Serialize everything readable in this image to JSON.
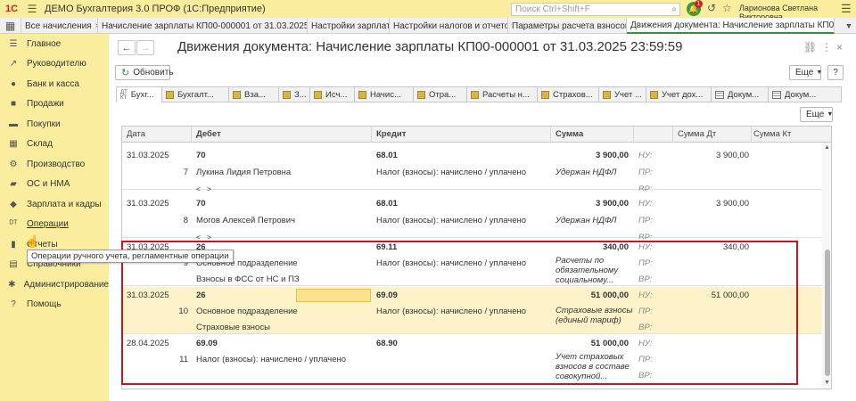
{
  "titlebar": {
    "logo": "1С",
    "title": "ДЕМО Бухгалтерия 3.0 ПРОФ  (1С:Предприятие)",
    "search_placeholder": "Поиск Ctrl+Shift+F",
    "notification_count": "1",
    "user": "Ларионова Светлана Викторовна"
  },
  "open_tabs": [
    {
      "label": "Все начисления"
    },
    {
      "label": "Начисление зарплаты КП00-000001 от 31.03.2025 2..."
    },
    {
      "label": "Настройки зарплаты"
    },
    {
      "label": "Настройки налогов и отчетов"
    },
    {
      "label": "Параметры расчета взносов"
    },
    {
      "label": "Движения документа: Начисление зарплаты КП0..."
    }
  ],
  "sidebar": {
    "items": [
      {
        "label": "Главное",
        "icon": "menu-icon"
      },
      {
        "label": "Руководителю",
        "icon": "trend-icon"
      },
      {
        "label": "Банк и касса",
        "icon": "bank-icon"
      },
      {
        "label": "Продажи",
        "icon": "bag-icon"
      },
      {
        "label": "Покупки",
        "icon": "cart-icon"
      },
      {
        "label": "Склад",
        "icon": "warehouse-icon"
      },
      {
        "label": "Производство",
        "icon": "factory-icon"
      },
      {
        "label": "ОС и НМА",
        "icon": "car-icon"
      },
      {
        "label": "Зарплата и кадры",
        "icon": "people-icon"
      },
      {
        "label": "Операции",
        "icon": "operations-icon"
      },
      {
        "label": "Отчеты",
        "icon": "reports-icon"
      },
      {
        "label": "Справочники",
        "icon": "book-icon"
      },
      {
        "label": "Администрирование",
        "icon": "gear-icon"
      },
      {
        "label": "Помощь",
        "icon": "help-icon"
      }
    ],
    "tooltip": "Операции ручного учета, регламентные операции"
  },
  "document": {
    "title": "Движения документа: Начисление зарплаты КП00-000001 от 31.03.2025 23:59:59",
    "refresh_label": "Обновить",
    "more_label": "Еще",
    "help_label": "?",
    "grid_more_label": "Еще"
  },
  "register_tabs": [
    {
      "label": "Бухг...",
      "icon": "dt-kt"
    },
    {
      "label": "Бухгалт..."
    },
    {
      "label": "Вза..."
    },
    {
      "label": "З..."
    },
    {
      "label": "Исч..."
    },
    {
      "label": "Начис..."
    },
    {
      "label": "Отра..."
    },
    {
      "label": "Расчеты н..."
    },
    {
      "label": "Страхов..."
    },
    {
      "label": "Учет ..."
    },
    {
      "label": "Учет дох..."
    },
    {
      "label": "Докум...",
      "icon": "table"
    },
    {
      "label": "Докум...",
      "icon": "table"
    }
  ],
  "grid": {
    "headers": {
      "date": "Дата",
      "debit": "Дебет",
      "credit": "Кредит",
      "sum": "Сумма",
      "sum_dt": "Сумма Дт",
      "sum_kt": "Сумма Кт"
    },
    "rows": [
      {
        "date": "31.03.2025",
        "num": "7",
        "debit_acc": "70",
        "debit_sub1": "Лукина Лидия Петровна",
        "debit_sub2": "<...>",
        "credit_acc": "68.01",
        "credit_sub1": "Налог (взносы): начислено / уплачено",
        "sum": "3 900,00",
        "content": "Удержан НДФЛ",
        "nu": "НУ:",
        "pr": "ПР:",
        "vr": "ВР:",
        "sum_dt": "3 900,00",
        "sum_kt": ""
      },
      {
        "date": "31.03.2025",
        "num": "8",
        "debit_acc": "70",
        "debit_sub1": "Могов Алексей Петрович",
        "debit_sub2": "<...>",
        "credit_acc": "68.01",
        "credit_sub1": "Налог (взносы): начислено / уплачено",
        "sum": "3 900,00",
        "content": "Удержан НДФЛ",
        "nu": "НУ:",
        "pr": "ПР:",
        "vr": "ВР:",
        "sum_dt": "3 900,00",
        "sum_kt": ""
      },
      {
        "date": "31.03.2025",
        "num": "9",
        "debit_acc": "26",
        "debit_sub1": "Основное подразделение",
        "debit_sub2": "Взносы в ФСС от НС и ПЗ",
        "credit_acc": "69.11",
        "credit_sub1": "Налог (взносы): начислено / уплачено",
        "sum": "340,00",
        "content": "Расчеты по обязательному социальному...",
        "nu": "НУ:",
        "pr": "ПР:",
        "vr": "ВР:",
        "sum_dt": "340,00",
        "sum_kt": ""
      },
      {
        "date": "31.03.2025",
        "num": "10",
        "debit_acc": "26",
        "debit_sub1": "Основное подразделение",
        "debit_sub2": "Страховые взносы",
        "credit_acc": "69.09",
        "credit_sub1": "Налог (взносы): начислено / уплачено",
        "sum": "51 000,00",
        "content": "Страховые взносы (единый тариф)",
        "nu": "НУ:",
        "pr": "ПР:",
        "vr": "ВР:",
        "sum_dt": "51 000,00",
        "sum_kt": ""
      },
      {
        "date": "28.04.2025",
        "num": "11",
        "debit_acc": "69.09",
        "debit_sub1": "Налог (взносы): начислено / уплачено",
        "debit_sub2": "",
        "credit_acc": "68.90",
        "credit_sub1": "",
        "sum": "51 000,00",
        "content": "Учет страховых взносов в составе совокупной...",
        "nu": "НУ:",
        "pr": "ПР:",
        "vr": "ВР:",
        "sum_dt": "",
        "sum_kt": ""
      }
    ]
  },
  "colors": {
    "sidebar_bg": "#fbed9e",
    "selected_row": "#fdf2c8",
    "highlight_border": "#c7141d",
    "accent_green": "#3b8f3b"
  }
}
